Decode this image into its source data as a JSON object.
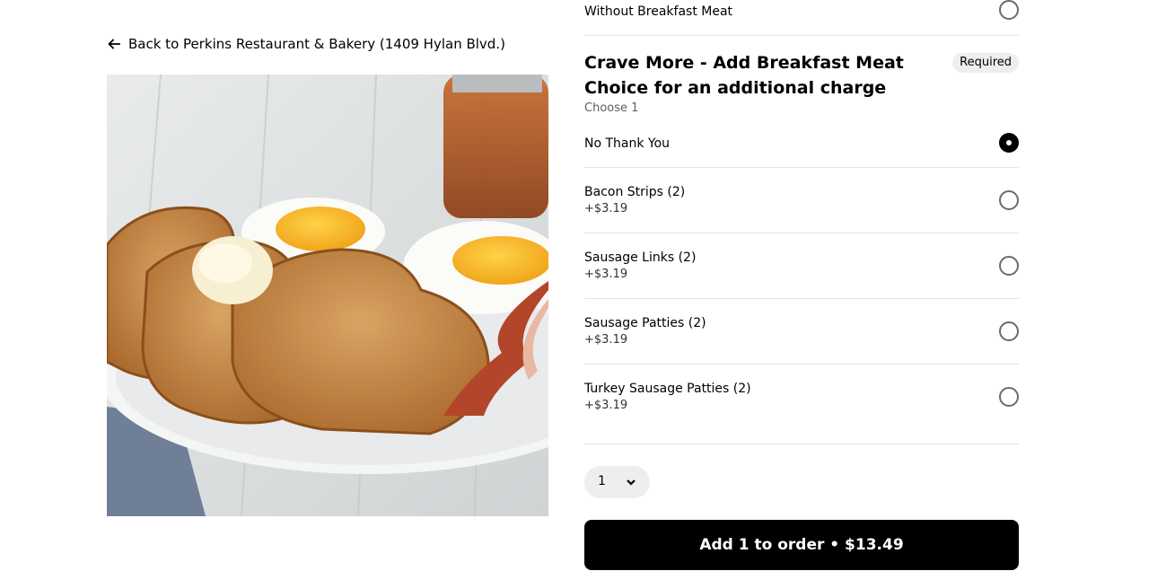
{
  "nav": {
    "back_label": "Back to Perkins Restaurant & Bakery (1409 Hylan Blvd.)",
    "back_icon": "arrow-left-icon"
  },
  "item_image": {
    "description_icon": "french-toast-photo"
  },
  "previous_option": {
    "label": "Without Breakfast Meat",
    "selected": false
  },
  "section": {
    "title": "Crave More - Add Breakfast Meat Choice for an additional charge",
    "badge": "Required",
    "subtitle": "Choose 1",
    "options": [
      {
        "label": "No Thank You",
        "price": "",
        "selected": true
      },
      {
        "label": "Bacon Strips (2)",
        "price": "+$3.19",
        "selected": false
      },
      {
        "label": "Sausage Links (2)",
        "price": "+$3.19",
        "selected": false
      },
      {
        "label": "Sausage Patties (2)",
        "price": "+$3.19",
        "selected": false
      },
      {
        "label": "Turkey Sausage Patties (2)",
        "price": "+$3.19",
        "selected": false
      }
    ]
  },
  "quantity": {
    "value": "1",
    "icon": "chevron-down-icon"
  },
  "cta": {
    "label": "Add 1 to order • $13.49"
  },
  "colors": {
    "primary": "#000000",
    "badge_bg": "#eeeeee",
    "divider": "#e2e2e2",
    "radio_border": "#6b6b6b"
  }
}
